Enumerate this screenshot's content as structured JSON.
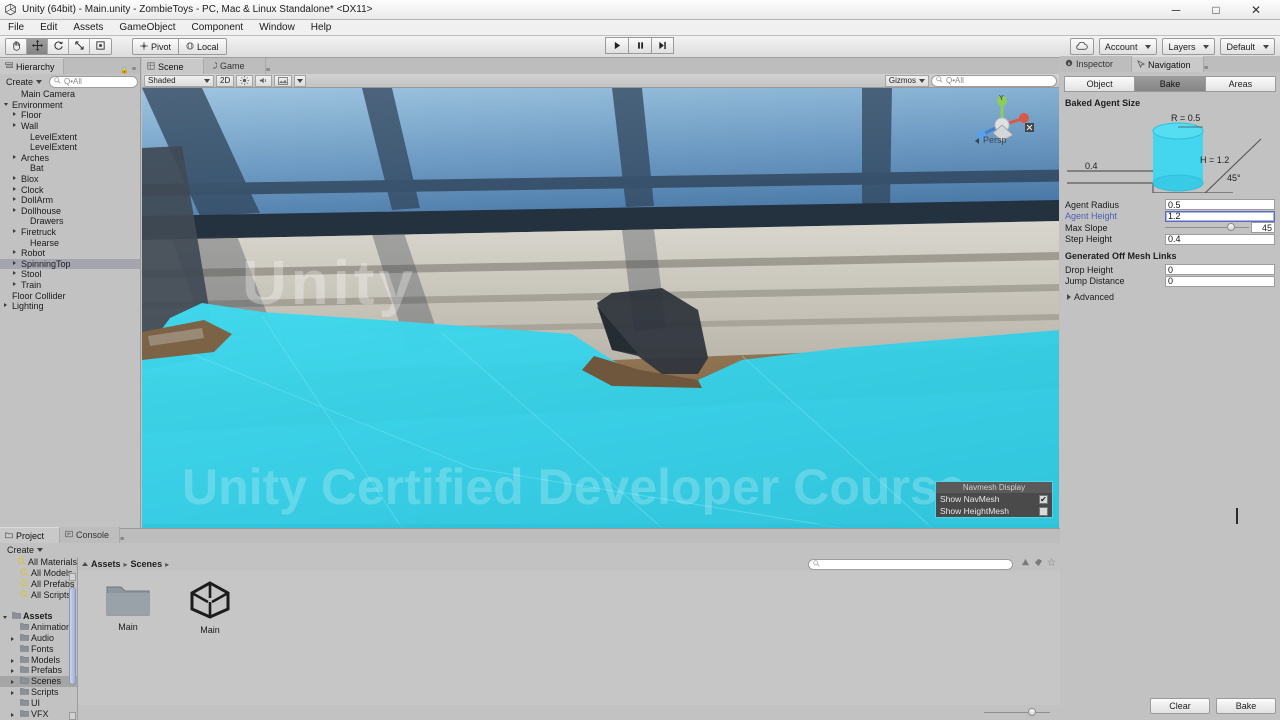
{
  "window": {
    "title": "Unity (64bit) - Main.unity - ZombieToys - PC, Mac & Linux Standalone* <DX11>",
    "logo_icon": "unity-logo-icon",
    "minimize_label": "─",
    "maximize_label": "□",
    "close_label": "✕"
  },
  "menu": {
    "items": [
      "File",
      "Edit",
      "Assets",
      "GameObject",
      "Component",
      "Window",
      "Help"
    ]
  },
  "toolbar": {
    "transform_tools": [
      {
        "name": "hand-tool",
        "glyph": "✋",
        "active": false
      },
      {
        "name": "move-tool",
        "glyph": "✥",
        "active": true
      },
      {
        "name": "rotate-tool",
        "glyph": "↻",
        "active": false
      },
      {
        "name": "scale-tool",
        "glyph": "⤢",
        "active": false
      },
      {
        "name": "rect-tool",
        "glyph": "▣",
        "active": false
      }
    ],
    "pivot_label": "Pivot",
    "space_label": "Local",
    "play_label": "▶",
    "pause_label": "▐▐",
    "step_label": "▶▏",
    "cloud_label": "☁",
    "account_label": "Account",
    "layers_label": "Layers",
    "layout_label": "Default"
  },
  "hierarchy": {
    "tab_label": "Hierarchy",
    "create_label": "Create",
    "search_placeholder": "Q•All",
    "items": [
      {
        "label": "Main Camera",
        "indent": 1,
        "arrow": "none",
        "selected": false
      },
      {
        "label": "Environment",
        "indent": 0,
        "arrow": "open",
        "selected": false
      },
      {
        "label": "Floor",
        "indent": 1,
        "arrow": "closed",
        "selected": false
      },
      {
        "label": "Wall",
        "indent": 1,
        "arrow": "closed",
        "selected": false
      },
      {
        "label": "LevelExtent",
        "indent": 2,
        "arrow": "none",
        "selected": false
      },
      {
        "label": "LevelExtent",
        "indent": 2,
        "arrow": "none",
        "selected": false
      },
      {
        "label": "Arches",
        "indent": 1,
        "arrow": "closed",
        "selected": false
      },
      {
        "label": "Bat",
        "indent": 2,
        "arrow": "none",
        "selected": false
      },
      {
        "label": "Blox",
        "indent": 1,
        "arrow": "closed",
        "selected": false
      },
      {
        "label": "Clock",
        "indent": 1,
        "arrow": "closed",
        "selected": false
      },
      {
        "label": "DollArm",
        "indent": 1,
        "arrow": "closed",
        "selected": false
      },
      {
        "label": "Dollhouse",
        "indent": 1,
        "arrow": "closed",
        "selected": false
      },
      {
        "label": "Drawers",
        "indent": 2,
        "arrow": "none",
        "selected": false
      },
      {
        "label": "Firetruck",
        "indent": 1,
        "arrow": "closed",
        "selected": false
      },
      {
        "label": "Hearse",
        "indent": 2,
        "arrow": "none",
        "selected": false
      },
      {
        "label": "Robot",
        "indent": 1,
        "arrow": "closed",
        "selected": false
      },
      {
        "label": "SpinningTop",
        "indent": 1,
        "arrow": "closed",
        "selected": true
      },
      {
        "label": "Stool",
        "indent": 1,
        "arrow": "closed",
        "selected": false
      },
      {
        "label": "Train",
        "indent": 1,
        "arrow": "closed",
        "selected": false
      },
      {
        "label": "Floor Collider",
        "indent": 0,
        "arrow": "none",
        "selected": false
      },
      {
        "label": "Lighting",
        "indent": 0,
        "arrow": "closed",
        "selected": false
      }
    ]
  },
  "scene": {
    "tabs": [
      {
        "label": "Scene",
        "selected": true,
        "icon": "scene-icon"
      },
      {
        "label": "Game",
        "selected": false,
        "icon": "game-icon"
      }
    ],
    "shading_mode": "Shaded",
    "mode_2d_label": "2D",
    "lighting_icon": "lighting-toggle-icon",
    "audio_icon": "audio-toggle-icon",
    "fx_icon": "effects-toggle-icon",
    "gizmos_label": "Gizmos",
    "gizmos_search_placeholder": "Q•All",
    "axis_gizmo": {
      "perspective_label": "Persp",
      "y_label": "Y",
      "x_label": "X",
      "z_label": "Z"
    },
    "navmesh_display": {
      "title": "Navmesh Display",
      "rows": [
        {
          "label": "Show NavMesh",
          "checked": true
        },
        {
          "label": "Show HeightMesh",
          "checked": false
        }
      ]
    },
    "watermarks": [
      "Unity",
      "Unity Certified Developer Course"
    ],
    "navmesh_color": "#3fd6ea"
  },
  "inspector": {
    "tabs": [
      {
        "label": "Inspector",
        "selected": false,
        "icon": "inspector-icon"
      },
      {
        "label": "Navigation",
        "selected": true,
        "icon": "navigation-icon"
      }
    ],
    "segments": [
      {
        "label": "Object",
        "active": false
      },
      {
        "label": "Bake",
        "active": true
      },
      {
        "label": "Areas",
        "active": false
      }
    ],
    "baked_agent_size": {
      "header": "Baked Agent Size",
      "radius_label": "R = 0.5",
      "height_label": "H = 1.2",
      "step_label": "0.4",
      "slope_label": "45°"
    },
    "fields": [
      {
        "label": "Agent Radius",
        "value": "0.5",
        "type": "text",
        "focused": false,
        "editing": false
      },
      {
        "label": "Agent Height",
        "value": "1.2",
        "type": "text",
        "focused": true,
        "editing": true
      },
      {
        "label": "Max Slope",
        "value": "45",
        "type": "slider",
        "focused": false,
        "editing": false
      },
      {
        "label": "Step Height",
        "value": "0.4",
        "type": "text",
        "focused": false,
        "editing": false
      }
    ],
    "offmesh_header": "Generated Off Mesh Links",
    "offmesh_fields": [
      {
        "label": "Drop Height",
        "value": "0"
      },
      {
        "label": "Jump Distance",
        "value": "0"
      }
    ],
    "advanced_label": "Advanced",
    "clear_label": "Clear",
    "bake_label": "Bake"
  },
  "project": {
    "tabs": [
      {
        "label": "Project",
        "selected": true,
        "icon": "project-icon"
      },
      {
        "label": "Console",
        "selected": false,
        "icon": "console-icon"
      }
    ],
    "create_label": "Create",
    "tree": [
      {
        "label": "All Materials",
        "indent": 1,
        "arrow": "none",
        "bold": false,
        "icon": "search-saved-icon",
        "selected": false,
        "clipped": true
      },
      {
        "label": "All Models",
        "indent": 1,
        "arrow": "none",
        "bold": false,
        "icon": "search-saved-icon",
        "selected": false
      },
      {
        "label": "All Prefabs",
        "indent": 1,
        "arrow": "none",
        "bold": false,
        "icon": "search-saved-icon",
        "selected": false
      },
      {
        "label": "All Scripts",
        "indent": 1,
        "arrow": "none",
        "bold": false,
        "icon": "search-saved-icon",
        "selected": false
      },
      {
        "label": "",
        "indent": 0,
        "arrow": "none",
        "bold": false,
        "icon": "none",
        "selected": false
      },
      {
        "label": "Assets",
        "indent": 0,
        "arrow": "open",
        "bold": true,
        "icon": "folder-icon",
        "selected": false
      },
      {
        "label": "Animations",
        "indent": 1,
        "arrow": "none",
        "bold": false,
        "icon": "folder-icon",
        "selected": false
      },
      {
        "label": "Audio",
        "indent": 1,
        "arrow": "closed",
        "bold": false,
        "icon": "folder-icon",
        "selected": false
      },
      {
        "label": "Fonts",
        "indent": 1,
        "arrow": "none",
        "bold": false,
        "icon": "folder-icon",
        "selected": false
      },
      {
        "label": "Models",
        "indent": 1,
        "arrow": "closed",
        "bold": false,
        "icon": "folder-icon",
        "selected": false
      },
      {
        "label": "Prefabs",
        "indent": 1,
        "arrow": "closed",
        "bold": false,
        "icon": "folder-icon",
        "selected": false
      },
      {
        "label": "Scenes",
        "indent": 1,
        "arrow": "closed",
        "bold": false,
        "icon": "folder-icon",
        "selected": true
      },
      {
        "label": "Scripts",
        "indent": 1,
        "arrow": "closed",
        "bold": false,
        "icon": "folder-icon",
        "selected": false
      },
      {
        "label": "UI",
        "indent": 1,
        "arrow": "none",
        "bold": false,
        "icon": "folder-icon",
        "selected": false
      },
      {
        "label": "VFX",
        "indent": 1,
        "arrow": "closed",
        "bold": false,
        "icon": "folder-icon",
        "selected": false
      }
    ],
    "breadcrumb": [
      "Assets",
      "Scenes"
    ],
    "search_placeholder": "",
    "assets": [
      {
        "label": "Main",
        "type": "folder"
      },
      {
        "label": "Main",
        "type": "unity-scene"
      }
    ]
  }
}
